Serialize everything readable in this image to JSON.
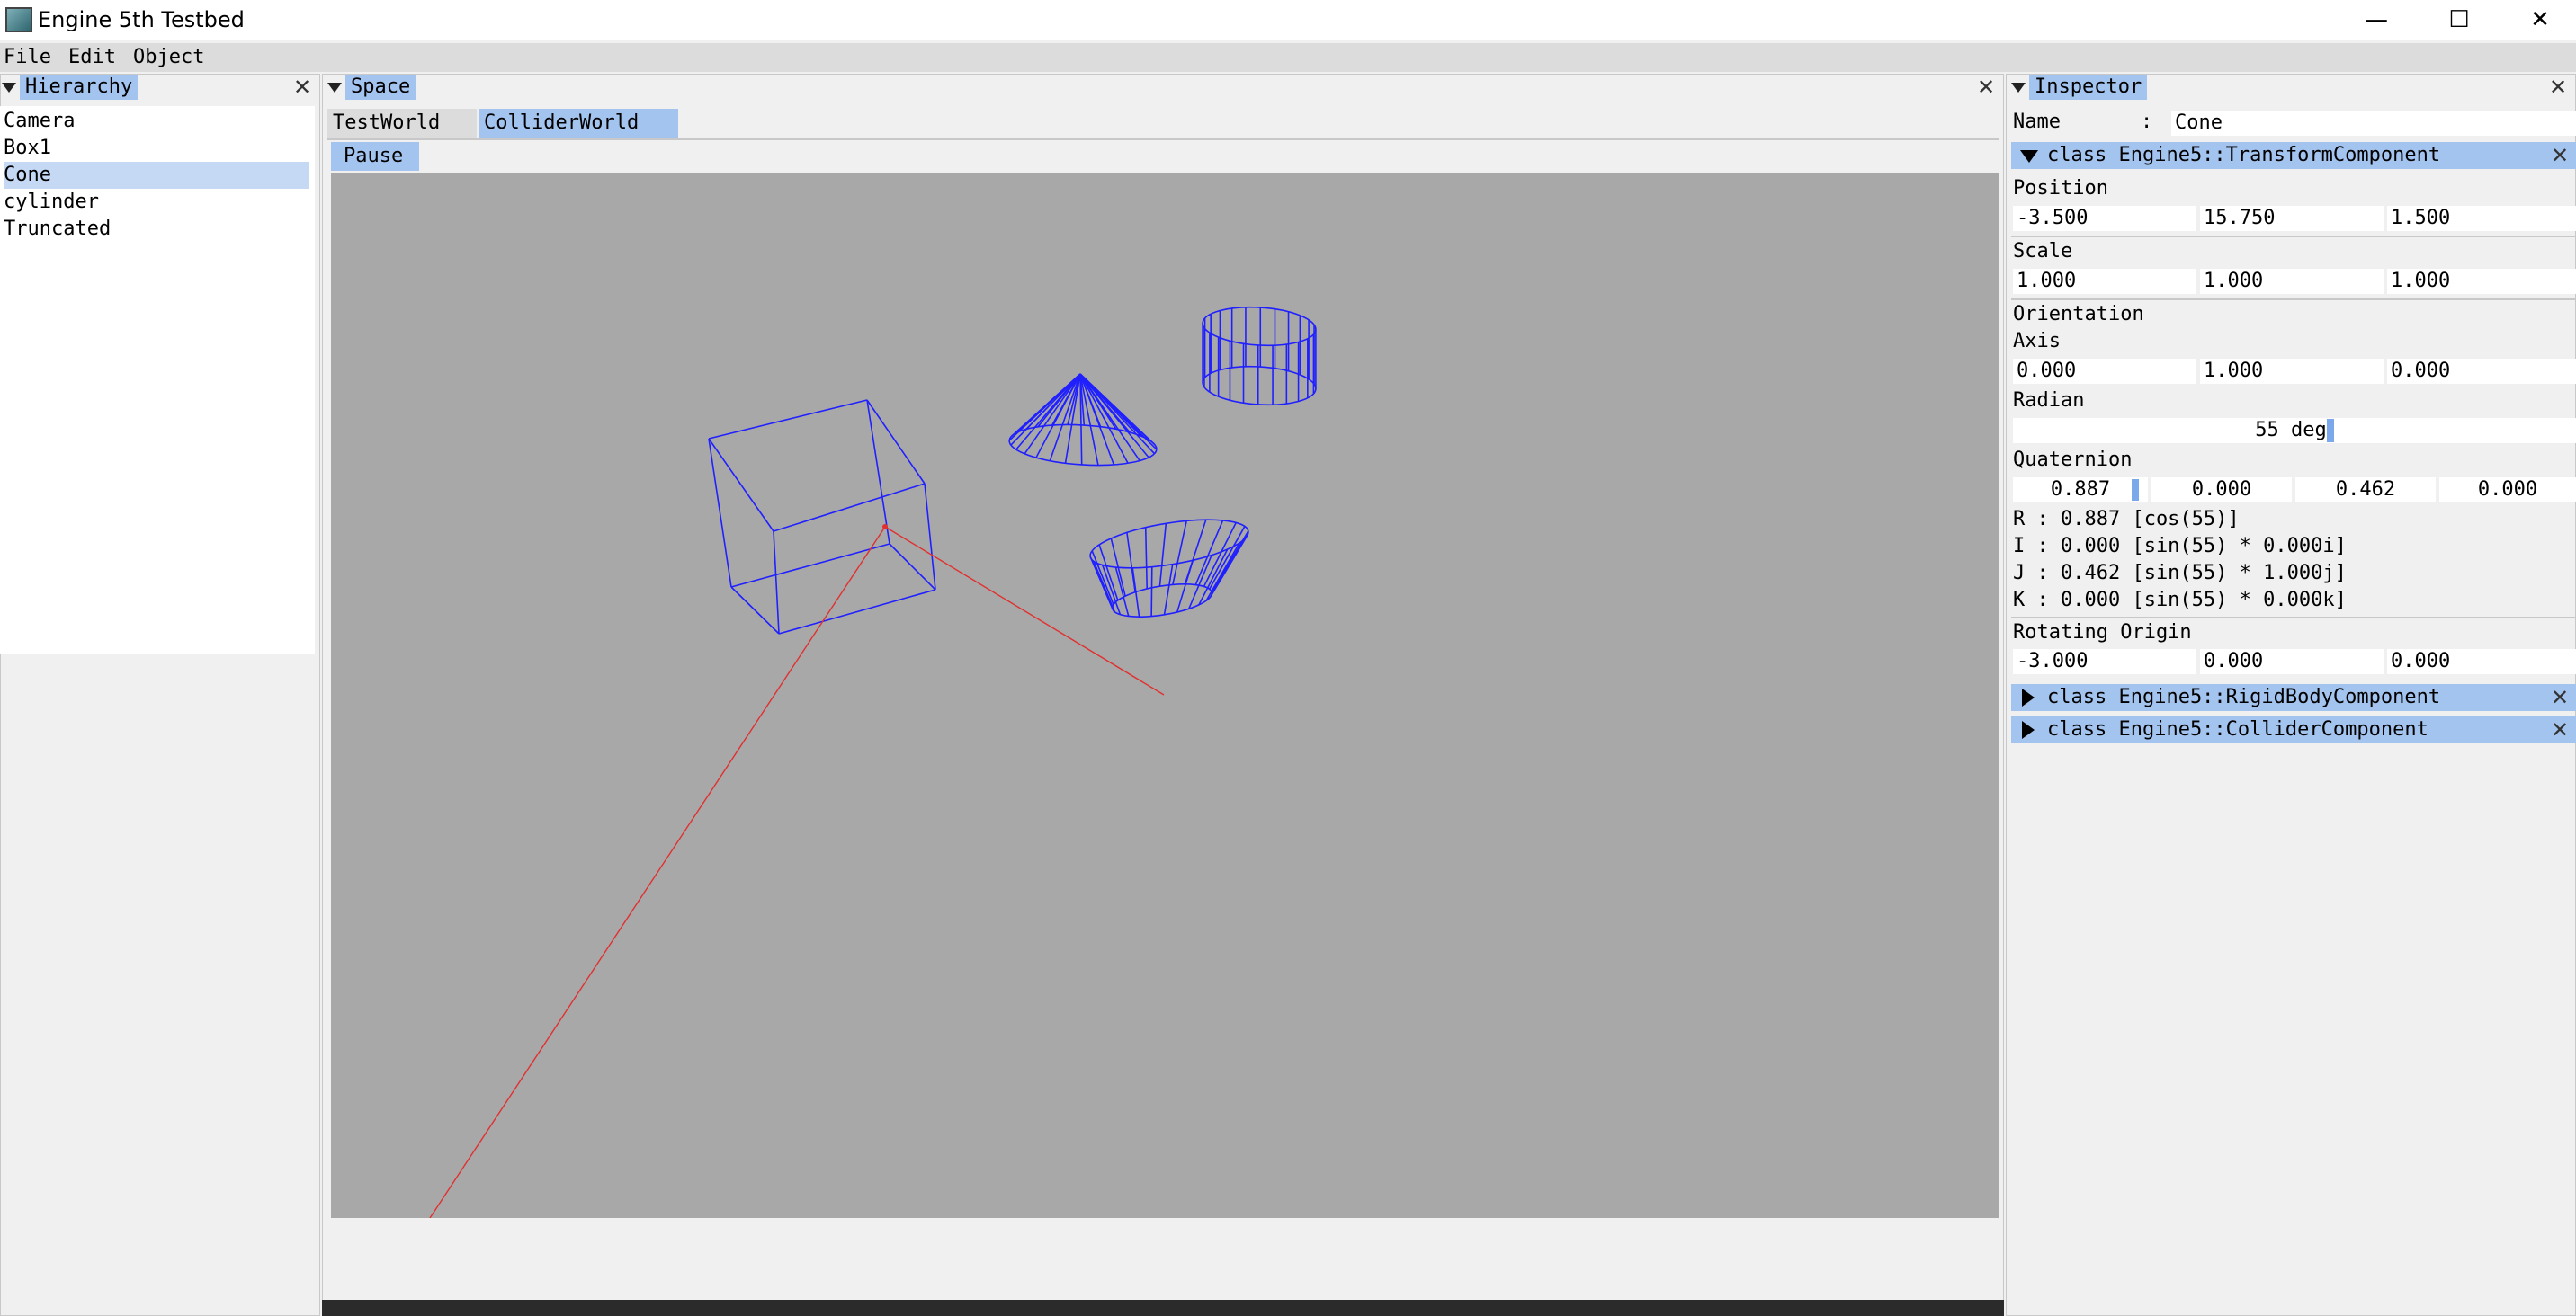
{
  "window": {
    "title": "Engine 5th Testbed",
    "controls": [
      "—",
      "☐",
      "✕"
    ]
  },
  "menu": [
    "File",
    "Edit",
    "Object"
  ],
  "hierarchy": {
    "title": "Hierarchy",
    "items": [
      "Camera",
      "Box1",
      "Cone",
      "cylinder",
      "Truncated"
    ],
    "selected": "Cone"
  },
  "space": {
    "title": "Space",
    "tabs": [
      "TestWorld",
      "ColliderWorld"
    ],
    "active_tab": "ColliderWorld",
    "pause_label": "Pause",
    "wire_color": "#2020ff",
    "ray_color": "#e03030"
  },
  "inspector": {
    "title": "Inspector",
    "name_label": "Name",
    "name_sep": ":",
    "name_value": "Cone",
    "transform_component": "class Engine5::TransformComponent",
    "position_label": "Position",
    "position": [
      "-3.500",
      "15.750",
      "1.500"
    ],
    "scale_label": "Scale",
    "scale": [
      "1.000",
      "1.000",
      "1.000"
    ],
    "orientation_label": "Orientation",
    "axis_label": "Axis",
    "axis": [
      "0.000",
      "1.000",
      "0.000"
    ],
    "radian_label": "Radian",
    "radian_value": "55 deg",
    "quaternion_label": "Quaternion",
    "quaternion": [
      "0.887",
      "0.000",
      "0.462",
      "0.000"
    ],
    "quat_lines": [
      "R : 0.887 [cos(55)]",
      "I : 0.000 [sin(55) * 0.000i]",
      "J : 0.462 [sin(55) * 1.000j]",
      "K : 0.000 [sin(55) * 0.000k]"
    ],
    "rotating_origin_label": "Rotating Origin",
    "rotating_origin": [
      "-3.000",
      "0.000",
      "0.000"
    ],
    "rigidbody_component": "class Engine5::RigidBodyComponent",
    "collider_component": "class Engine5::ColliderComponent",
    "accent": "#a3c4ef"
  }
}
